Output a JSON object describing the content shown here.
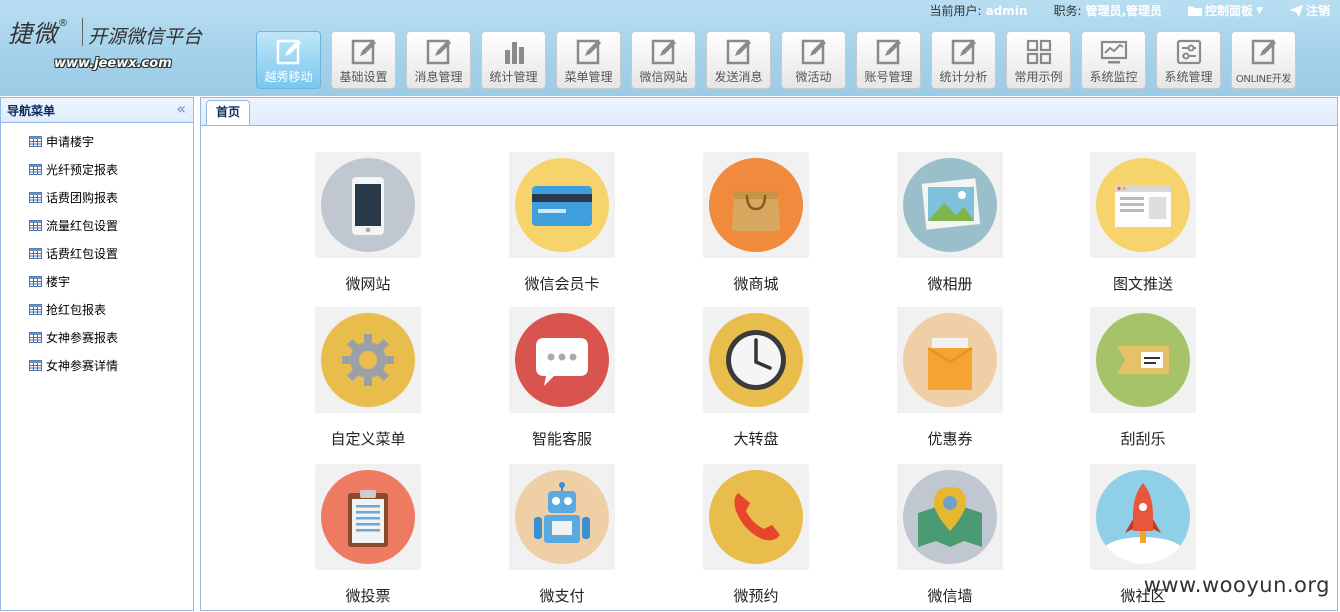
{
  "logo": {
    "main": "捷微",
    "registered": "®",
    "subtitle": "开源微信平台",
    "url": "www.jeewx.com"
  },
  "userbar": {
    "user_label": "当前用户:",
    "user_value": "admin",
    "role_label": "职务:",
    "role_value": "管理员,管理员",
    "control_panel": "控制面板",
    "logout": "注销"
  },
  "nav": [
    {
      "label": "越秀移动",
      "icon": "edit-icon",
      "active": true
    },
    {
      "label": "基础设置",
      "icon": "edit-icon"
    },
    {
      "label": "消息管理",
      "icon": "edit-icon"
    },
    {
      "label": "统计管理",
      "icon": "bar-chart-icon"
    },
    {
      "label": "菜单管理",
      "icon": "edit-icon"
    },
    {
      "label": "微信网站",
      "icon": "edit-icon"
    },
    {
      "label": "发送消息",
      "icon": "edit-icon"
    },
    {
      "label": "微活动",
      "icon": "edit-icon"
    },
    {
      "label": "账号管理",
      "icon": "edit-icon"
    },
    {
      "label": "统计分析",
      "icon": "edit-icon"
    },
    {
      "label": "常用示例",
      "icon": "grid-icon"
    },
    {
      "label": "系统监控",
      "icon": "monitor-icon"
    },
    {
      "label": "系统管理",
      "icon": "sliders-icon"
    },
    {
      "label": "ONLINE开发",
      "icon": "edit-icon"
    }
  ],
  "sidebar": {
    "title": "导航菜单",
    "collapse_icon": "double-chevron-left-icon",
    "items": [
      "申请楼宇",
      "光纤预定报表",
      "话费团购报表",
      "流量红包设置",
      "话费红包设置",
      "楼宇",
      "抢红包报表",
      "女神参赛报表",
      "女神参赛详情"
    ]
  },
  "tabs": [
    {
      "label": "首页"
    }
  ],
  "apps": [
    {
      "label": "微网站",
      "icon": "smartphone-icon",
      "color": "#c1c7d0"
    },
    {
      "label": "微信会员卡",
      "icon": "credit-card-icon",
      "color": "#f6d36b"
    },
    {
      "label": "微商城",
      "icon": "shopping-bag-icon",
      "color": "#f08a3c"
    },
    {
      "label": "微相册",
      "icon": "photo-album-icon",
      "color": "#9bbfca"
    },
    {
      "label": "图文推送",
      "icon": "browser-window-icon",
      "color": "#f6d36b"
    },
    {
      "label": "自定义菜单",
      "icon": "gear-icon",
      "color": "#e9bd4c"
    },
    {
      "label": "智能客服",
      "icon": "chat-bubble-icon",
      "color": "#d9534f"
    },
    {
      "label": "大转盘",
      "icon": "clock-icon",
      "color": "#e9bd4c"
    },
    {
      "label": "优惠券",
      "icon": "coupon-envelope-icon",
      "color": "#efcfa5"
    },
    {
      "label": "刮刮乐",
      "icon": "ticket-icon",
      "color": "#a6c36a"
    },
    {
      "label": "微投票",
      "icon": "clipboard-icon",
      "color": "#ee7a62"
    },
    {
      "label": "微支付",
      "icon": "robot-icon",
      "color": "#efcfa5"
    },
    {
      "label": "微预约",
      "icon": "phone-icon",
      "color": "#e9bd4c"
    },
    {
      "label": "微信墙",
      "icon": "map-pin-icon",
      "color": "#c1c7d0"
    },
    {
      "label": "微社区",
      "icon": "rocket-icon",
      "color": "#8fd0e8"
    }
  ],
  "watermark": "www.wooyun.org"
}
